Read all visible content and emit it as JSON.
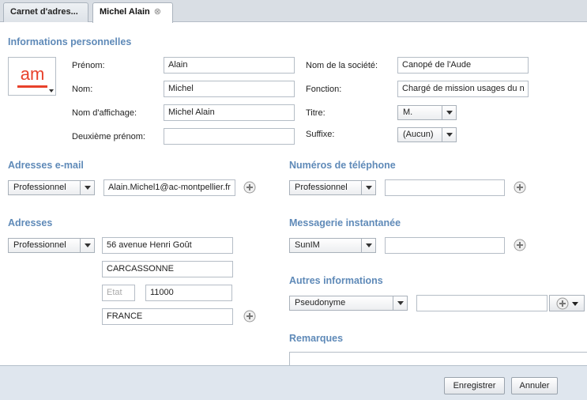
{
  "tabs": [
    {
      "label": "Carnet d'adres..."
    },
    {
      "label": "Michel Alain"
    }
  ],
  "sections": {
    "personal": "Informations personnelles",
    "emails": "Adresses e-mail",
    "phones": "Numéros de téléphone",
    "addresses": "Adresses",
    "im": "Messagerie instantanée",
    "other": "Autres informations",
    "notes": "Remarques"
  },
  "avatar": {
    "text": "am",
    "color": "#e8412b"
  },
  "personal": {
    "firstname_label": "Prénom:",
    "firstname_value": "Alain",
    "lastname_label": "Nom:",
    "lastname_value": "Michel",
    "display_label": "Nom d'affichage:",
    "display_value": "Michel Alain",
    "middle_label": "Deuxième prénom:",
    "middle_value": "",
    "company_label": "Nom de la société:",
    "company_value": "Canopé de l'Aude",
    "function_label": "Fonction:",
    "function_value": "Chargé de mission usages du n",
    "title_label": "Titre:",
    "title_value": "M.",
    "suffix_label": "Suffixe:",
    "suffix_value": "(Aucun)"
  },
  "email": {
    "type": "Professionnel",
    "value": "Alain.Michel1@ac-montpellier.fr"
  },
  "phone": {
    "type": "Professionnel",
    "value": ""
  },
  "address": {
    "type": "Professionnel",
    "street": "56 avenue Henri Goût",
    "city": "CARCASSONNE",
    "state_placeholder": "Etat",
    "zip": "11000",
    "country": "FRANCE"
  },
  "im": {
    "type": "SunIM",
    "value": ""
  },
  "other": {
    "type": "Pseudonyme",
    "value": ""
  },
  "buttons": {
    "save": "Enregistrer",
    "cancel": "Annuler"
  },
  "colors": {
    "section_title": "#5f8ab8",
    "footer": "#dfe6ee",
    "plus_icon": "#9a9a9a"
  }
}
